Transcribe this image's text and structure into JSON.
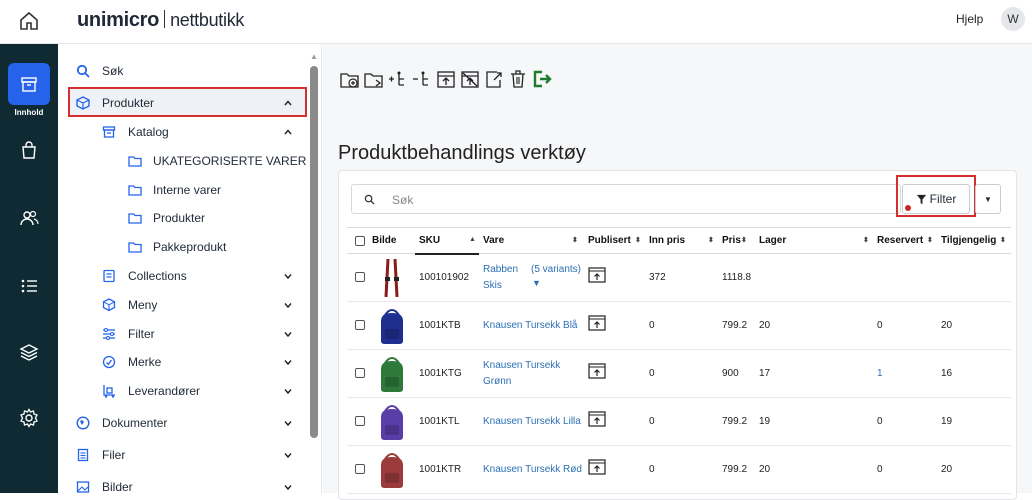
{
  "header": {
    "logo_main": "unimicro",
    "logo_sub": "nettbutikk",
    "help": "Hjelp",
    "avatar": "W"
  },
  "rail": {
    "active_label": "Innhold",
    "icons": [
      "box-icon",
      "bag-icon",
      "users-icon",
      "list-icon",
      "layers-icon",
      "gear-icon"
    ]
  },
  "sidebar": {
    "search": "Søk",
    "produkter": "Produkter",
    "katalog": "Katalog",
    "katalog_items": [
      "UKATEGORISERTE VARER",
      "Interne varer",
      "Produkter",
      "Pakkeprodukt"
    ],
    "collections": "Collections",
    "meny": "Meny",
    "filter": "Filter",
    "merke": "Merke",
    "leverandorer": "Leverandører",
    "dokumenter": "Dokumenter",
    "filer": "Filer",
    "bilder": "Bilder"
  },
  "page": {
    "title": "Produktbehandlings verktøy",
    "search_placeholder": "Søk",
    "filter_label": "Filter"
  },
  "table": {
    "headers": [
      "Bilde",
      "SKU",
      "Vare",
      "Publisert",
      "Inn pris",
      "Pris",
      "Lager",
      "Reservert",
      "Tilgjengelig"
    ],
    "rows": [
      {
        "sku": "100101902",
        "name1": "Rabben",
        "name2": "Skis",
        "variants": "(5 variants)",
        "inn": "372",
        "pris": "1118.8",
        "lager": "",
        "reservert": "",
        "tilgj": "",
        "img": "skis",
        "color": "#8b1a1a"
      },
      {
        "sku": "1001KTB",
        "name1": "Knausen Tursekk Blå",
        "name2": "",
        "variants": "",
        "inn": "0",
        "pris": "799.2",
        "lager": "20",
        "reservert": "0",
        "tilgj": "20",
        "img": "bag",
        "color": "#1f2f8f"
      },
      {
        "sku": "1001KTG",
        "name1": "Knausen Tursekk",
        "name2": "Grønn",
        "variants": "",
        "inn": "0",
        "pris": "900",
        "lager": "17",
        "reservert": "1",
        "tilgj": "16",
        "img": "bag",
        "color": "#2f7a3a"
      },
      {
        "sku": "1001KTL",
        "name1": "Knausen Tursekk Lilla",
        "name2": "",
        "variants": "",
        "inn": "0",
        "pris": "799.2",
        "lager": "19",
        "reservert": "0",
        "tilgj": "19",
        "img": "bag",
        "color": "#5a3ea8"
      },
      {
        "sku": "1001KTR",
        "name1": "Knausen Tursekk Rød",
        "name2": "",
        "variants": "",
        "inn": "0",
        "pris": "799.2",
        "lager": "20",
        "reservert": "0",
        "tilgj": "20",
        "img": "bag",
        "color": "#9b3b3b"
      }
    ]
  }
}
